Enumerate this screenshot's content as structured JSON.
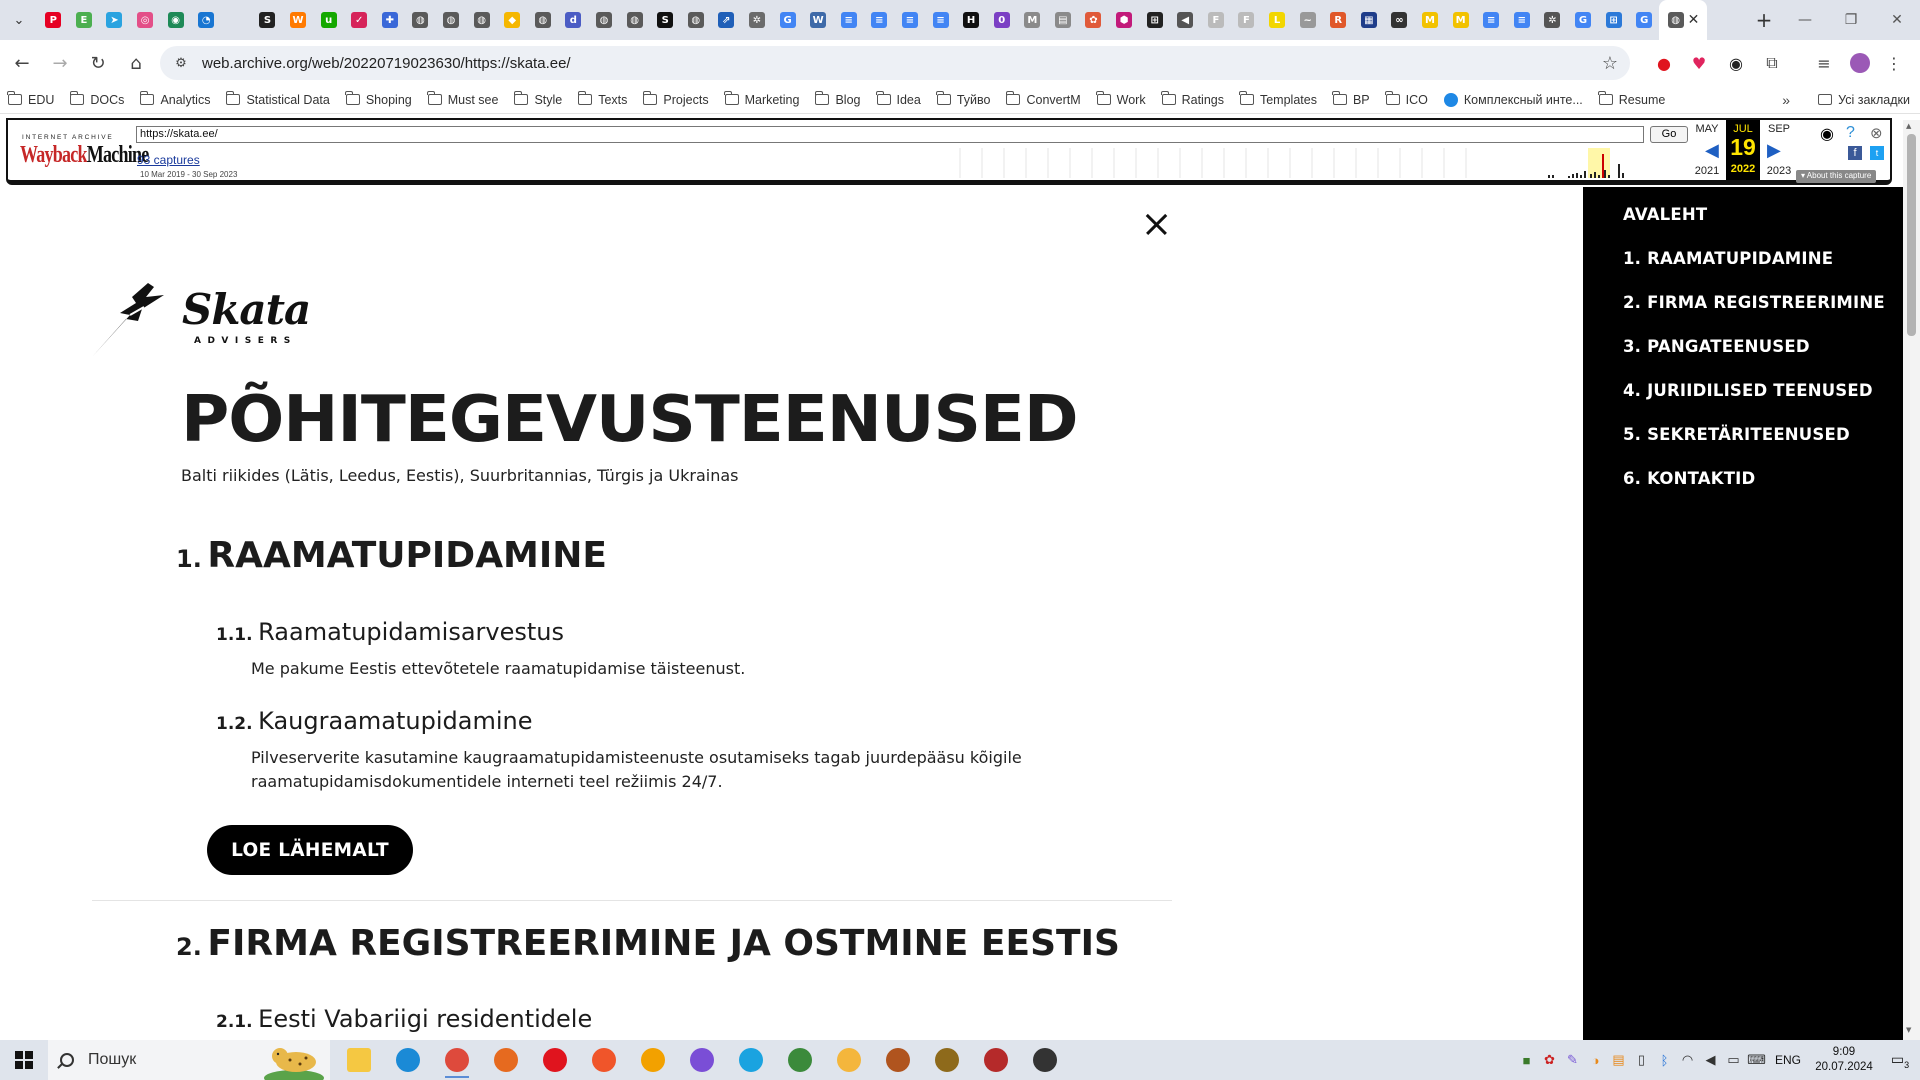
{
  "browser": {
    "tabs": [
      {
        "icon": "pinterest-icon",
        "color": "#e60023",
        "glyph": "P"
      },
      {
        "icon": "evernote-icon",
        "color": "#4caf50",
        "glyph": "E"
      },
      {
        "icon": "telegram-icon",
        "color": "#2aa3e0",
        "glyph": "➤"
      },
      {
        "icon": "app-icon",
        "color": "#e34f88",
        "glyph": "◎"
      },
      {
        "icon": "app-icon",
        "color": "#1e8a57",
        "glyph": "◉"
      },
      {
        "icon": "app-icon",
        "color": "#1976d2",
        "glyph": "◔"
      },
      {
        "icon": "blank-icon",
        "color": "#ffffff",
        "glyph": ""
      },
      {
        "icon": "sce-icon",
        "color": "#222222",
        "glyph": "S"
      },
      {
        "icon": "orange-icon",
        "color": "#ff7a00",
        "glyph": "W"
      },
      {
        "icon": "upwork-icon",
        "color": "#14a800",
        "glyph": "u"
      },
      {
        "icon": "app-icon",
        "color": "#d6245a",
        "glyph": "✓"
      },
      {
        "icon": "app-icon",
        "color": "#3a68d8",
        "glyph": "✚"
      },
      {
        "icon": "globe-icon",
        "color": "#5a5a5a",
        "glyph": "◍"
      },
      {
        "icon": "globe-icon",
        "color": "#5a5a5a",
        "glyph": "◍"
      },
      {
        "icon": "globe-icon",
        "color": "#5a5a5a",
        "glyph": "◍"
      },
      {
        "icon": "app-icon",
        "color": "#f5b700",
        "glyph": "◆"
      },
      {
        "icon": "globe-icon",
        "color": "#5a5a5a",
        "glyph": "◍"
      },
      {
        "icon": "app-icon",
        "color": "#4b5cc4",
        "glyph": "d"
      },
      {
        "icon": "globe-icon",
        "color": "#5a5a5a",
        "glyph": "◍"
      },
      {
        "icon": "globe-icon",
        "color": "#5a5a5a",
        "glyph": "◍"
      },
      {
        "icon": "s-icon",
        "color": "#111111",
        "glyph": "S"
      },
      {
        "icon": "globe-icon",
        "color": "#5a5a5a",
        "glyph": "◍"
      },
      {
        "icon": "app-icon",
        "color": "#1f5fb8",
        "glyph": "⇗"
      },
      {
        "icon": "openai-icon",
        "color": "#6b6b6b",
        "glyph": "✲"
      },
      {
        "icon": "google-icon",
        "color": "#4285f4",
        "glyph": "G"
      },
      {
        "icon": "app-icon",
        "color": "#3e6aa8",
        "glyph": "W"
      },
      {
        "icon": "docs-icon",
        "color": "#4285f4",
        "glyph": "≡"
      },
      {
        "icon": "docs-icon",
        "color": "#4285f4",
        "glyph": "≡"
      },
      {
        "icon": "docs-icon",
        "color": "#4285f4",
        "glyph": "≡"
      },
      {
        "icon": "docs-icon",
        "color": "#4285f4",
        "glyph": "≡"
      },
      {
        "icon": "app-icon",
        "color": "#111111",
        "glyph": "H"
      },
      {
        "icon": "app-icon",
        "color": "#7b3fc4",
        "glyph": "0"
      },
      {
        "icon": "app-icon",
        "color": "#8a8a8a",
        "glyph": "M"
      },
      {
        "icon": "app-icon",
        "color": "#8a8a8a",
        "glyph": "▤"
      },
      {
        "icon": "app-icon",
        "color": "#e05a3a",
        "glyph": "✿"
      },
      {
        "icon": "app-icon",
        "color": "#c21a7a",
        "glyph": "⬢"
      },
      {
        "icon": "app-icon",
        "color": "#222222",
        "glyph": "⊞"
      },
      {
        "icon": "sound-icon",
        "color": "#555555",
        "glyph": "◀"
      },
      {
        "icon": "app-icon",
        "color": "#bbbbbb",
        "glyph": "F"
      },
      {
        "icon": "app-icon",
        "color": "#bbbbbb",
        "glyph": "F"
      },
      {
        "icon": "app-icon",
        "color": "#f2d600",
        "glyph": "L"
      },
      {
        "icon": "app-icon",
        "color": "#999999",
        "glyph": "~"
      },
      {
        "icon": "app-icon",
        "color": "#e0582a",
        "glyph": "R"
      },
      {
        "icon": "app-icon",
        "color": "#1f3d8a",
        "glyph": "▦"
      },
      {
        "icon": "link-icon",
        "color": "#333333",
        "glyph": "∞"
      },
      {
        "icon": "app-icon",
        "color": "#f2c200",
        "glyph": "M"
      },
      {
        "icon": "app-icon",
        "color": "#f2c200",
        "glyph": "M"
      },
      {
        "icon": "docs-icon",
        "color": "#4285f4",
        "glyph": "≡"
      },
      {
        "icon": "docs-icon",
        "color": "#4285f4",
        "glyph": "≡"
      },
      {
        "icon": "chatgpt-icon",
        "color": "#555555",
        "glyph": "✲"
      },
      {
        "icon": "google-icon",
        "color": "#4285f4",
        "glyph": "G"
      },
      {
        "icon": "app-icon",
        "color": "#2b79d8",
        "glyph": "⊞"
      },
      {
        "icon": "google-icon",
        "color": "#4285f4",
        "glyph": "G"
      }
    ],
    "address": "web.archive.org/web/20220719023630/https://skata.ee/",
    "bookmarks": [
      "EDU",
      "DOCs",
      "Analytics",
      "Statistical Data",
      "Shoping",
      "Must see",
      "Style",
      "Texts",
      "Projects",
      "Marketing",
      "Blog",
      "Idea",
      "Туйво",
      "ConvertM",
      "Work",
      "Ratings",
      "Templates",
      "BP",
      "ICO"
    ],
    "bookmark_special": "Комплексный инте...",
    "bookmark_after": "Resume",
    "bookmarks_more": "»",
    "bookmarks_all": "Усі закладки"
  },
  "wayback": {
    "logo_top": "INTERNET ARCHIVE",
    "logo_a": "Wayback",
    "logo_b": "Machine",
    "url": "https://skata.ee/",
    "go": "Go",
    "captures": "93 captures",
    "range": "10 Mar 2019 - 30 Sep 2023",
    "prev_month": "MAY",
    "cur_month": "JUL",
    "next_month": "SEP",
    "prev_year": "2021",
    "cur_day": "19",
    "cur_year": "2022",
    "next_year": "2023",
    "about": "About this capture"
  },
  "page": {
    "logo_word": "Skata",
    "logo_sub": "ADVISERS",
    "title": "PÕHITEGEVUSTEENUSED",
    "subtitle": "Balti riikides (Lätis, Leedus, Eestis), Suurbritannias, Türgis ja Ukrainas",
    "sections": [
      {
        "num": "1.",
        "title": "RAAMATUPIDAMINE"
      },
      {
        "num": "2.",
        "title": "FIRMA REGISTREERIMINE JA OSTMINE EESTIS"
      }
    ],
    "subsections": [
      {
        "num": "1.1.",
        "title": "Raamatupidamisarvestus",
        "text": "Me pakume Eestis ettevõtetele raamatupidamise täisteenust."
      },
      {
        "num": "1.2.",
        "title": "Kaugraamatupidamine",
        "text_line1": "Pilveserverite kasutamine kaugraamatupidamisteenuste osutamiseks tagab juurdepääsu kõigile",
        "text_line2": "raamatupidamisdokumentidele interneti teel režiimis 24/7."
      },
      {
        "num": "2.1.",
        "title": "Eesti Vabariigi residentidele"
      }
    ],
    "read_more": "LOE LÄHEMALT"
  },
  "sidenav": [
    "AVALEHT",
    "1. RAAMATUPIDAMINE",
    "2. FIRMA REGISTREERIMINE",
    "3. PANGATEENUSED",
    "4. JURIIDILISED TEENUSED",
    "5. SEKRETÄRITEENUSED",
    "6. KONTAKTID"
  ],
  "taskbar": {
    "search_placeholder": "Пошук",
    "lang": "ENG",
    "time": "9:09",
    "date": "20.07.2024",
    "notifications": "3",
    "apps": [
      {
        "name": "file-explorer-icon",
        "color": "#f5c842"
      },
      {
        "name": "edge-icon",
        "color": "#1b8ad6"
      },
      {
        "name": "chrome-icon",
        "color": "#de4a3c"
      },
      {
        "name": "firefox-icon",
        "color": "#e66a1f"
      },
      {
        "name": "opera-icon",
        "color": "#e0141e"
      },
      {
        "name": "brave-icon",
        "color": "#f0552a"
      },
      {
        "name": "tor-icon",
        "color": "#f2a100"
      },
      {
        "name": "viber-icon",
        "color": "#7a4ed6"
      },
      {
        "name": "skype-icon",
        "color": "#1aa3e0"
      },
      {
        "name": "app-icon",
        "color": "#3b8a3b"
      },
      {
        "name": "app-icon",
        "color": "#f4b63c"
      },
      {
        "name": "app-icon",
        "color": "#b0541e"
      },
      {
        "name": "app-icon",
        "color": "#8e6a1b"
      },
      {
        "name": "app-icon",
        "color": "#b52a2a"
      },
      {
        "name": "app-icon",
        "color": "#333333"
      }
    ]
  }
}
